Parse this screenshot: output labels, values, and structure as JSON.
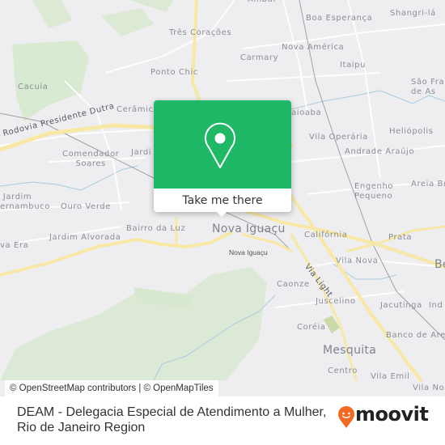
{
  "map": {
    "places": [
      {
        "name": "Três Corações",
        "size": "normal"
      },
      {
        "name": "Boa Esperança",
        "size": "normal"
      },
      {
        "name": "Shangri-lá",
        "size": "normal"
      },
      {
        "name": "Ambaí",
        "size": "normal"
      },
      {
        "name": "Nova América",
        "size": "normal"
      },
      {
        "name": "Carmary",
        "size": "normal"
      },
      {
        "name": "Itaipu",
        "size": "normal"
      },
      {
        "name": "Ponto Chic",
        "size": "normal"
      },
      {
        "name": "Cacuia",
        "size": "normal"
      },
      {
        "name": "São Francisco de Assis",
        "size": "normal"
      },
      {
        "name": "Cerâmica",
        "size": "normal"
      },
      {
        "name": "Caioaba",
        "size": "normal"
      },
      {
        "name": "Heliópolis",
        "size": "normal"
      },
      {
        "name": "Vila Operária",
        "size": "normal"
      },
      {
        "name": "Andrade Araújo",
        "size": "normal"
      },
      {
        "name": "Comendador Soares",
        "size": "normal"
      },
      {
        "name": "Jardim",
        "size": "normal"
      },
      {
        "name": "Engenho Pequeno",
        "size": "normal"
      },
      {
        "name": "Areia Branca",
        "size": "normal"
      },
      {
        "name": "Jardim Pernambuco",
        "size": "normal"
      },
      {
        "name": "Ouro Verde",
        "size": "normal"
      },
      {
        "name": "Bairro da Luz",
        "size": "normal"
      },
      {
        "name": "Nova Iguaçu",
        "size": "big"
      },
      {
        "name": "Califórnia",
        "size": "normal"
      },
      {
        "name": "Prata",
        "size": "normal"
      },
      {
        "name": "Nova Era",
        "size": "normal"
      },
      {
        "name": "Jardim Alvorada",
        "size": "normal"
      },
      {
        "name": "Nova Iguaçu",
        "size": "small"
      },
      {
        "name": "Vila Nova",
        "size": "normal"
      },
      {
        "name": "Caonze",
        "size": "normal"
      },
      {
        "name": "Juscelino",
        "size": "normal"
      },
      {
        "name": "Jacutinga",
        "size": "normal"
      },
      {
        "name": "Coréia",
        "size": "normal"
      },
      {
        "name": "Banco de Areia",
        "size": "normal"
      },
      {
        "name": "Mesquita",
        "size": "big"
      },
      {
        "name": "Centro",
        "size": "normal"
      },
      {
        "name": "Vila Emil",
        "size": "normal"
      },
      {
        "name": "Vila Norma",
        "size": "normal"
      },
      {
        "name": "Belford Roxo",
        "size": "big"
      },
      {
        "name": "Industrial",
        "size": "normal"
      }
    ],
    "roads": {
      "dutra": "Rodovia Presidente Dutra",
      "via_light": "Via Light"
    },
    "attribution": "© OpenStreetMap contributors | © OpenMapTiles"
  },
  "popup": {
    "icon": "map-pin-icon",
    "cta_label": "Take me there",
    "accent_color": "#1fb866"
  },
  "footer": {
    "title_line1": "DEAM - Delegacia Especial de Atendimento a Mulher,",
    "title_line2": "Rio de Janeiro Region",
    "brand": "moovit",
    "brand_color": "#f26a22"
  }
}
